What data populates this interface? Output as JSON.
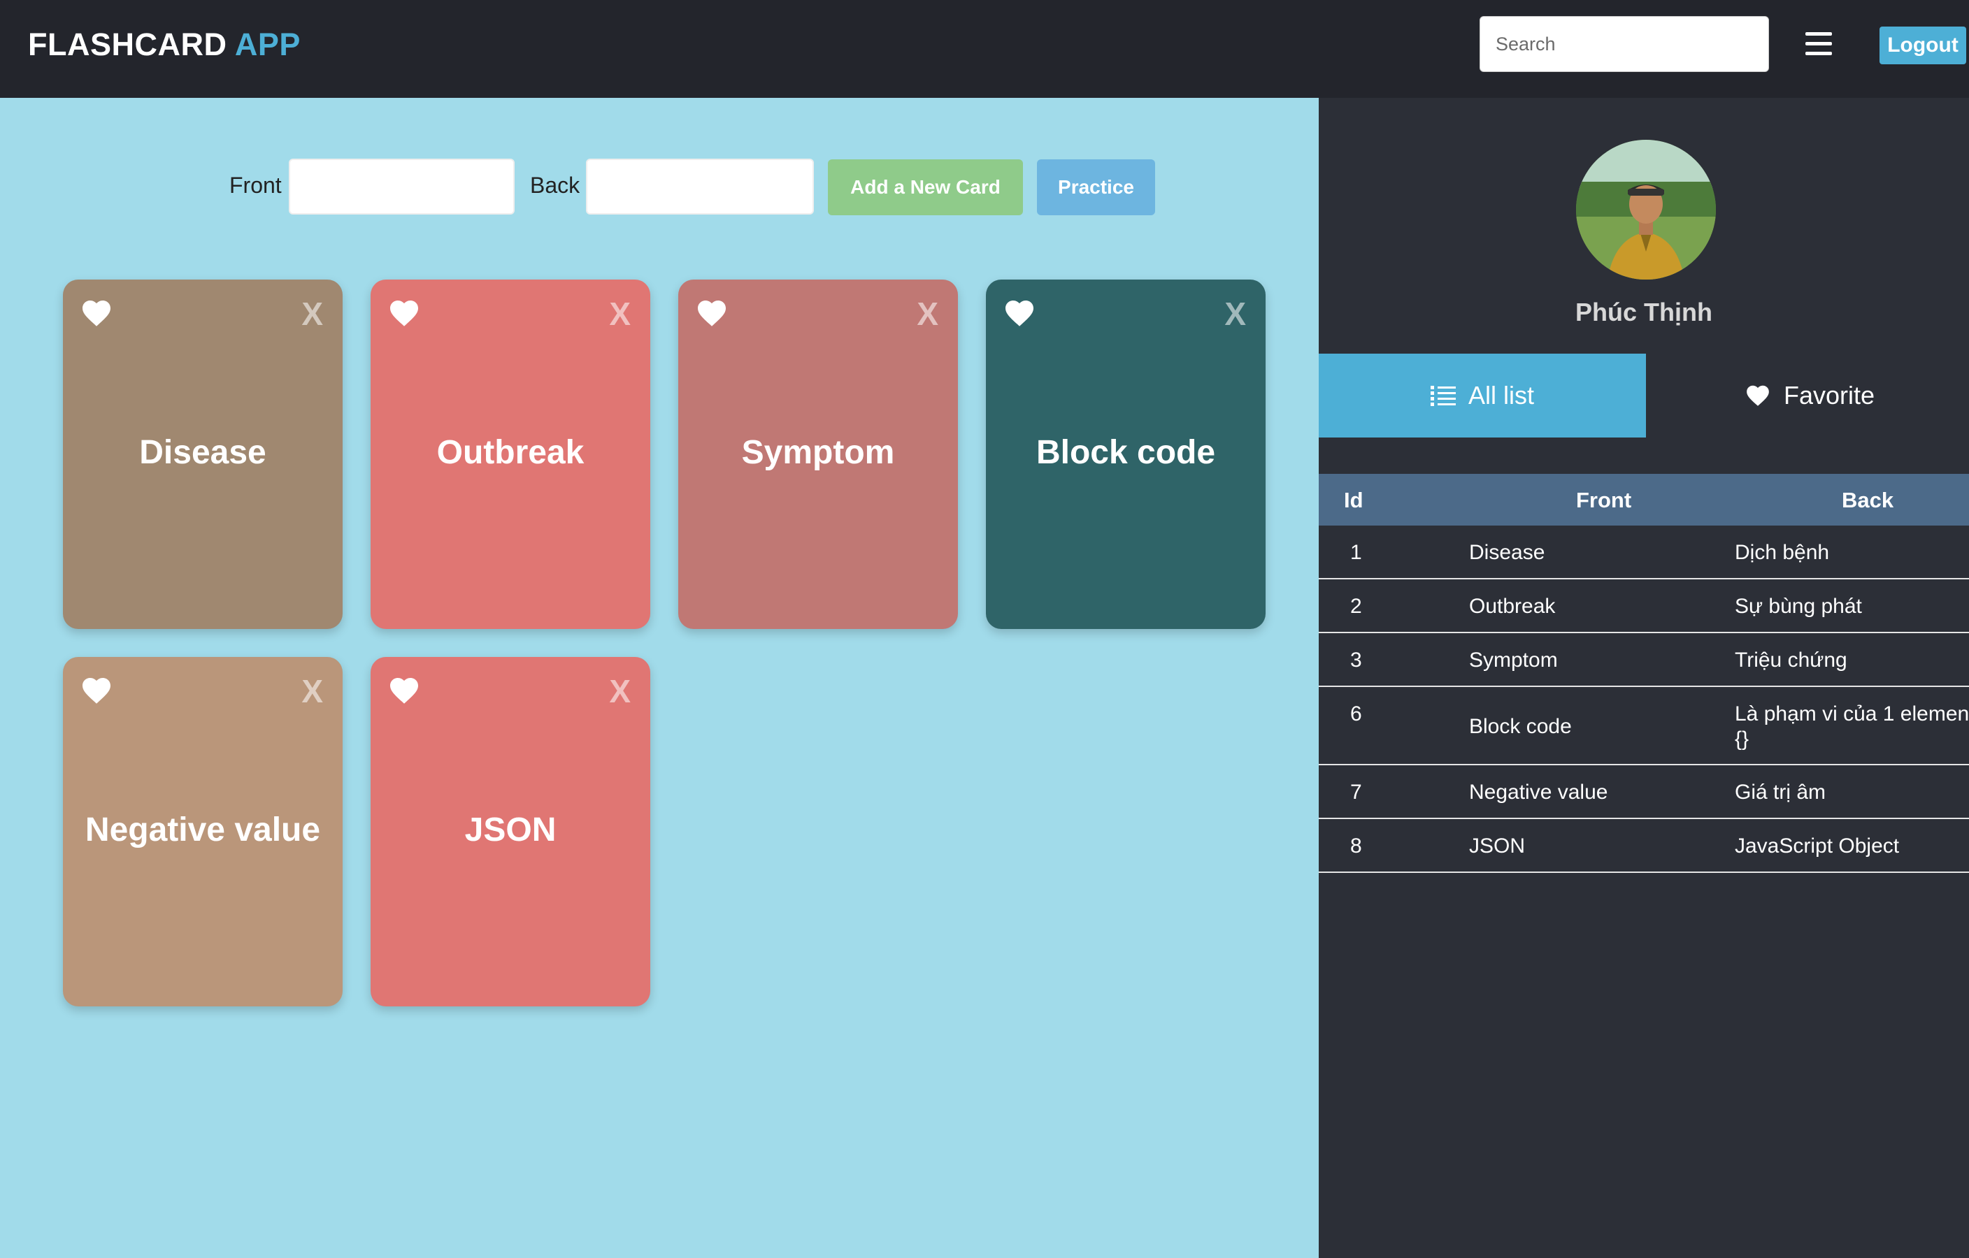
{
  "header": {
    "brand_main": "FLASHCARD",
    "brand_accent": "APP",
    "search_placeholder": "Search",
    "menu_icon": "hamburger-icon",
    "logout_label": "Logout"
  },
  "form": {
    "front_label": "Front",
    "back_label": "Back",
    "front_value": "",
    "back_value": "",
    "add_label": "Add a New Card",
    "practice_label": "Practice"
  },
  "cards": [
    {
      "word": "Disease",
      "color": "#a08870",
      "favorite_icon": "heart-icon",
      "delete_label": "X"
    },
    {
      "word": "Outbreak",
      "color": "#e07673",
      "favorite_icon": "heart-icon",
      "delete_label": "X"
    },
    {
      "word": "Symptom",
      "color": "#c07874",
      "favorite_icon": "heart-icon",
      "delete_label": "X"
    },
    {
      "word": "Block code",
      "color": "#2f6468",
      "favorite_icon": "heart-icon",
      "delete_label": "X"
    },
    {
      "word": "Negative value",
      "color": "#ba967a",
      "favorite_icon": "heart-icon",
      "delete_label": "X"
    },
    {
      "word": "JSON",
      "color": "#e07673",
      "favorite_icon": "heart-icon",
      "delete_label": "X"
    }
  ],
  "sidebar": {
    "username": "Phúc Thịnh",
    "tabs": [
      {
        "label": "All list",
        "icon": "list-icon",
        "active": true
      },
      {
        "label": "Favorite",
        "icon": "heart-icon",
        "active": false
      }
    ],
    "table": {
      "columns": [
        "Id",
        "Front",
        "Back"
      ],
      "rows": [
        {
          "id": "1",
          "front": "Disease",
          "back": "Dịch bệnh"
        },
        {
          "id": "2",
          "front": "Outbreak",
          "back": "Sự bùng phát"
        },
        {
          "id": "3",
          "front": "Symptom",
          "back": "Triệu chứng"
        },
        {
          "id": "6",
          "front": "Block code",
          "back": "Là phạm vi của 1 elemen",
          "back_line2": "{}"
        },
        {
          "id": "7",
          "front": "Negative value",
          "back": "Giá trị âm"
        },
        {
          "id": "8",
          "front": "JSON",
          "back": "JavaScript Object"
        }
      ]
    }
  },
  "colors": {
    "header_bg": "#23252c",
    "main_bg": "#a1dbea",
    "sidebar_bg": "#2c2f37",
    "accent": "#4dafd6",
    "add_button": "#8fcb8a",
    "practice_button": "#6db5e0",
    "table_header": "#4c6a89"
  }
}
